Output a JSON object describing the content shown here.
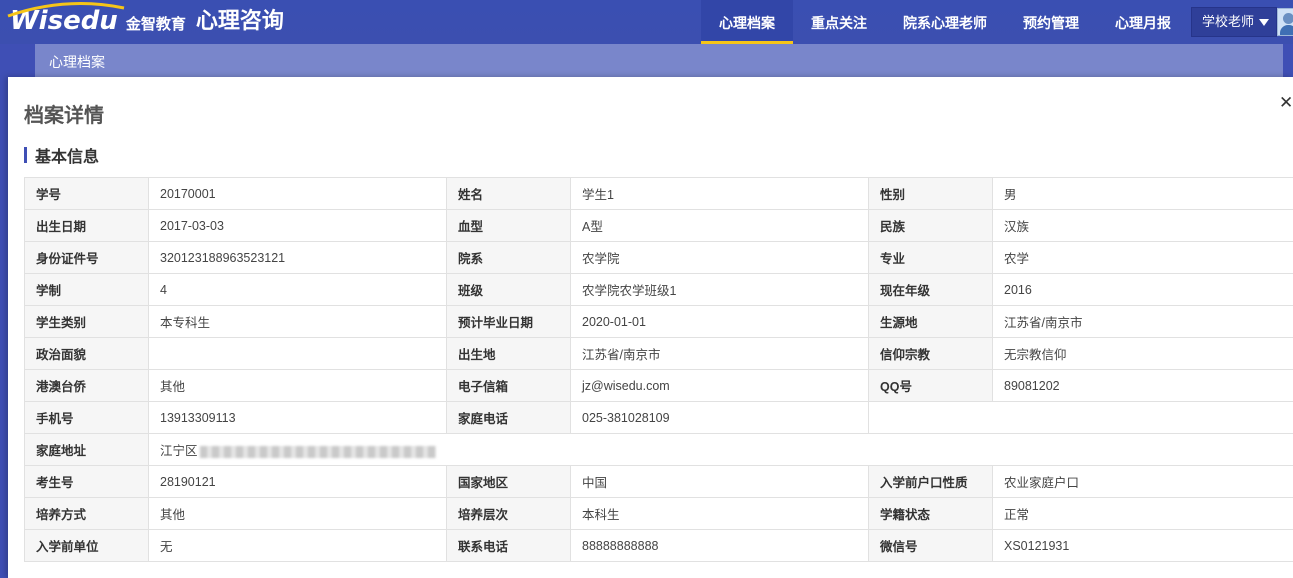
{
  "header": {
    "logo_text": "Wisedu",
    "logo_cn": "金智教育",
    "app_title": "心理咨询",
    "nav": [
      {
        "label": "心理档案",
        "active": true
      },
      {
        "label": "重点关注",
        "active": false
      },
      {
        "label": "院系心理老师",
        "active": false
      },
      {
        "label": "预约管理",
        "active": false
      },
      {
        "label": "心理月报",
        "active": false
      }
    ],
    "user_role": "学校老师",
    "accent_color": "#f5c518",
    "brand_color": "#3f4fb5"
  },
  "subbar": {
    "label": "心理档案"
  },
  "panel": {
    "title": "档案详情",
    "close_icon": "close-icon",
    "section_title": "基本信息"
  },
  "fields": {
    "student_id": {
      "label": "学号",
      "value": "20170001"
    },
    "name": {
      "label": "姓名",
      "value": "学生1"
    },
    "gender": {
      "label": "性别",
      "value": "男"
    },
    "birth_date": {
      "label": "出生日期",
      "value": "2017-03-03"
    },
    "blood_type": {
      "label": "血型",
      "value": "A型"
    },
    "ethnicity": {
      "label": "民族",
      "value": "汉族"
    },
    "id_number": {
      "label": "身份证件号",
      "value": "320123188963523121"
    },
    "department": {
      "label": "院系",
      "value": "农学院"
    },
    "major": {
      "label": "专业",
      "value": "农学"
    },
    "duration": {
      "label": "学制",
      "value": "4"
    },
    "class": {
      "label": "班级",
      "value": "农学院农学班级1"
    },
    "grade": {
      "label": "现在年级",
      "value": "2016"
    },
    "student_type": {
      "label": "学生类别",
      "value": "本专科生"
    },
    "graduation_date": {
      "label": "预计毕业日期",
      "value": "2020-01-01"
    },
    "origin": {
      "label": "生源地",
      "value": "江苏省/南京市"
    },
    "political_status": {
      "label": "政治面貌",
      "value": ""
    },
    "birthplace": {
      "label": "出生地",
      "value": "江苏省/南京市"
    },
    "religion": {
      "label": "信仰宗教",
      "value": "无宗教信仰"
    },
    "hmt_overseas": {
      "label": "港澳台侨",
      "value": "其他"
    },
    "email": {
      "label": "电子信箱",
      "value": "jz@wisedu.com"
    },
    "qq": {
      "label": "QQ号",
      "value": "89081202"
    },
    "mobile": {
      "label": "手机号",
      "value": "13913309113"
    },
    "home_phone": {
      "label": "家庭电话",
      "value": "025-381028109"
    },
    "home_address": {
      "label": "家庭地址",
      "value": "江宁区"
    },
    "exam_number": {
      "label": "考生号",
      "value": "28190121"
    },
    "country": {
      "label": "国家地区",
      "value": "中国"
    },
    "household_type": {
      "label": "入学前户口性质",
      "value": "农业家庭户口"
    },
    "training_mode": {
      "label": "培养方式",
      "value": "其他"
    },
    "training_level": {
      "label": "培养层次",
      "value": "本科生"
    },
    "enrollment_status": {
      "label": "学籍状态",
      "value": "正常"
    },
    "prior_unit": {
      "label": "入学前单位",
      "value": "无"
    },
    "contact_phone": {
      "label": "联系电话",
      "value": "88888888888"
    },
    "wechat": {
      "label": "微信号",
      "value": "XS0121931"
    }
  }
}
